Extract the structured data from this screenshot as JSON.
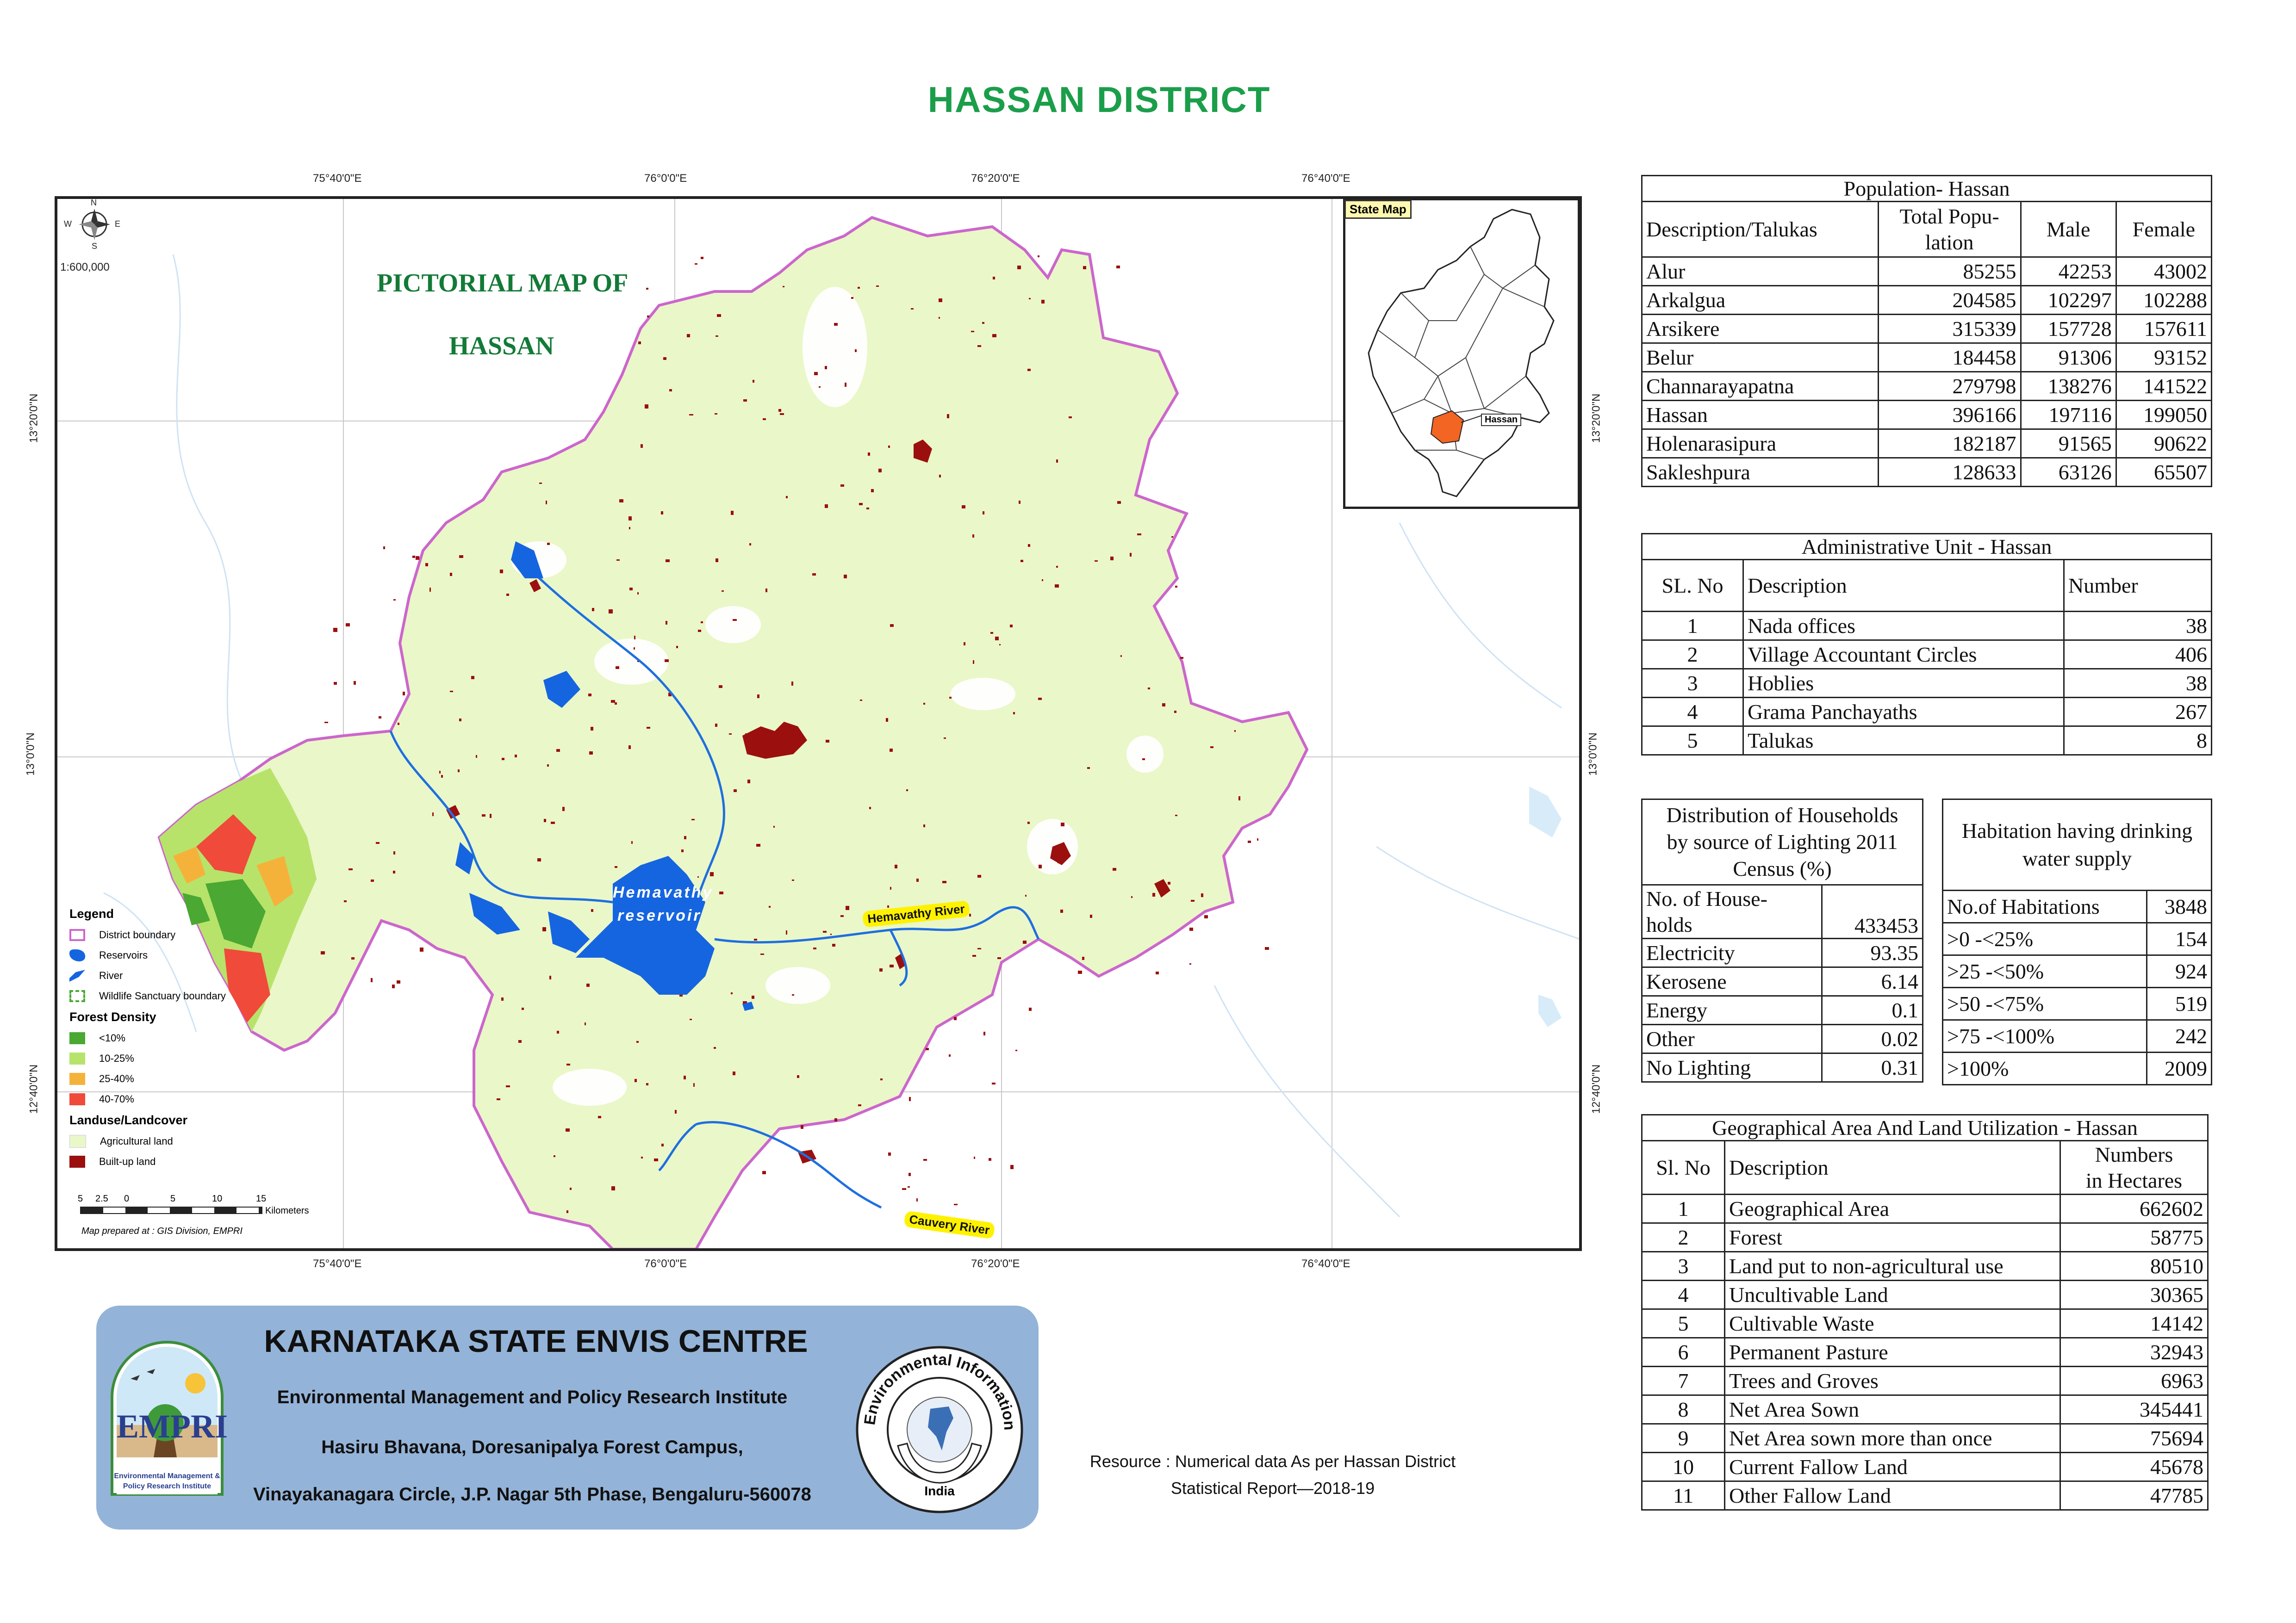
{
  "title": "HASSAN DISTRICT",
  "map": {
    "pictorial_title_line1": "PICTORIAL MAP OF",
    "pictorial_title_line2": "HASSAN",
    "scale_text": "1:600,000",
    "lon_ticks": [
      "75°40'0\"E",
      "76°0'0\"E",
      "76°20'0\"E",
      "76°40'0\"E"
    ],
    "lat_ticks": [
      "13°20'0\"N",
      "13°0'0\"N",
      "12°40'0\"N"
    ],
    "reservoir_label_1": "Hemavathy",
    "reservoir_label_2": "reservoir",
    "river_label_hemavathy": "Hemavathy River",
    "river_label_cauvery": "Cauvery River",
    "north_label": "N",
    "south_label": "S",
    "east_label": "E",
    "west_label": "W",
    "prepared_by": "Map prepared at : GIS Division, EMPRI",
    "scale_bar_numbers": [
      "5",
      "2.5",
      "0",
      "5",
      "10",
      "15"
    ],
    "scale_bar_unit": "Kilometers",
    "colors": {
      "district_boundary": "#cc66cc",
      "agricultural": "#eaf7c8",
      "builtup": "#9b0f0f",
      "water": "#1565e0",
      "river": "#1e6fe0",
      "forest_lt10": "#4aa833",
      "forest_10_25": "#b7e36b",
      "forest_25_40": "#f5b23a",
      "forest_40_70": "#f04a3a",
      "inset_highlight": "#f26522"
    }
  },
  "inset": {
    "title": "State Map",
    "label": "Hassan"
  },
  "legend": {
    "title": "Legend",
    "items": [
      {
        "label": "District boundary",
        "color": "#cc66cc",
        "kind": "outline"
      },
      {
        "label": "Reservoirs",
        "color": "#1565e0",
        "kind": "fill"
      },
      {
        "label": "River",
        "color": "#1565e0",
        "kind": "fill"
      },
      {
        "label": "Wildlife Sanctuary boundary",
        "color": "#4aa833",
        "kind": "dashed"
      }
    ],
    "forest_title": "Forest Density",
    "forest_items": [
      {
        "label": "<10%",
        "color": "#4aa833"
      },
      {
        "label": "10-25%",
        "color": "#b7e36b"
      },
      {
        "label": "25-40%",
        "color": "#f5b23a"
      },
      {
        "label": "40-70%",
        "color": "#f04a3a"
      }
    ],
    "landuse_title": "Landuse/Landcover",
    "landuse_items": [
      {
        "label": "Agricultural land",
        "color": "#eaf7c8"
      },
      {
        "label": "Built-up land",
        "color": "#9b0f0f"
      }
    ]
  },
  "banner": {
    "title": "KARNATAKA STATE ENVIS CENTRE",
    "line1": "Environmental Management and Policy Research Institute",
    "line2": "Hasiru Bhavana, Doresanipalya Forest Campus,",
    "line3": "Vinayakanagara Circle, J.P. Nagar 5th Phase, Bengaluru-560078",
    "empri_logo_text": "EMPRI",
    "empri_logo_sub1": "Environmental Management &",
    "empri_logo_sub2": "Policy Research Institute",
    "eis_logo_text": "Environmental Information System",
    "eis_logo_sub": "India"
  },
  "resource_line1": "Resource : Numerical data As per Hassan District",
  "resource_line2": "Statistical Report—2018-19",
  "population": {
    "caption": "Population- Hassan",
    "headers": [
      "Description/Talukas",
      "Total Popu-",
      "lation",
      "Male",
      "Female"
    ],
    "rows": [
      [
        "Alur",
        "85255",
        "42253",
        "43002"
      ],
      [
        "Arkalgua",
        "204585",
        "102297",
        "102288"
      ],
      [
        "Arsikere",
        "315339",
        "157728",
        "157611"
      ],
      [
        "Belur",
        "184458",
        "91306",
        "93152"
      ],
      [
        "Channarayapatna",
        "279798",
        "138276",
        "141522"
      ],
      [
        "Hassan",
        "396166",
        "197116",
        "199050"
      ],
      [
        "Holenarasipura",
        "182187",
        "91565",
        "90622"
      ],
      [
        "Sakleshpura",
        "128633",
        "63126",
        "65507"
      ]
    ]
  },
  "admin": {
    "caption": "Administrative Unit - Hassan",
    "headers": [
      "SL. No",
      "Description",
      "Number"
    ],
    "rows": [
      [
        "1",
        "Nada offices",
        "38"
      ],
      [
        "2",
        "Village Accountant Circles",
        "406"
      ],
      [
        "3",
        "Hoblies",
        "38"
      ],
      [
        "4",
        "Grama Panchayaths",
        "267"
      ],
      [
        "5",
        "Talukas",
        "8"
      ]
    ]
  },
  "lighting": {
    "caption1": "Distribution of Households",
    "caption2": "by source of Lighting 2011",
    "caption3": "Census (%)",
    "first_label1": "No. of House-",
    "first_label2": "holds",
    "first_value": "433453",
    "rows": [
      [
        "Electricity",
        "93.35"
      ],
      [
        "Kerosene",
        "6.14"
      ],
      [
        "Energy",
        "0.1"
      ],
      [
        "Other",
        "0.02"
      ],
      [
        "No Lighting",
        "0.31"
      ]
    ]
  },
  "water": {
    "caption1": "Habitation having drinking",
    "caption2": "water supply",
    "rows": [
      [
        "No.of Habitations",
        "3848"
      ],
      [
        ">0 -<25%",
        "154"
      ],
      [
        ">25 -<50%",
        "924"
      ],
      [
        ">50 -<75%",
        "519"
      ],
      [
        ">75 -<100%",
        "242"
      ],
      [
        ">100%",
        "2009"
      ]
    ]
  },
  "land": {
    "caption": "Geographical Area  And Land Utilization - Hassan",
    "headers": [
      "Sl. No",
      "Description",
      "Numbers",
      "in Hectares"
    ],
    "rows": [
      [
        "1",
        "Geographical Area",
        "662602"
      ],
      [
        "2",
        "Forest",
        "58775"
      ],
      [
        "3",
        "Land put to non-agricultural use",
        "80510"
      ],
      [
        "4",
        "Uncultivable Land",
        "30365"
      ],
      [
        "5",
        "Cultivable Waste",
        "14142"
      ],
      [
        "6",
        "Permanent Pasture",
        "32943"
      ],
      [
        "7",
        "Trees and Groves",
        "6963"
      ],
      [
        "8",
        "Net Area Sown",
        "345441"
      ],
      [
        "9",
        "Net Area sown more than once",
        "75694"
      ],
      [
        "10",
        "Current Fallow Land",
        "45678"
      ],
      [
        "11",
        "Other Fallow Land",
        "47785"
      ]
    ]
  }
}
